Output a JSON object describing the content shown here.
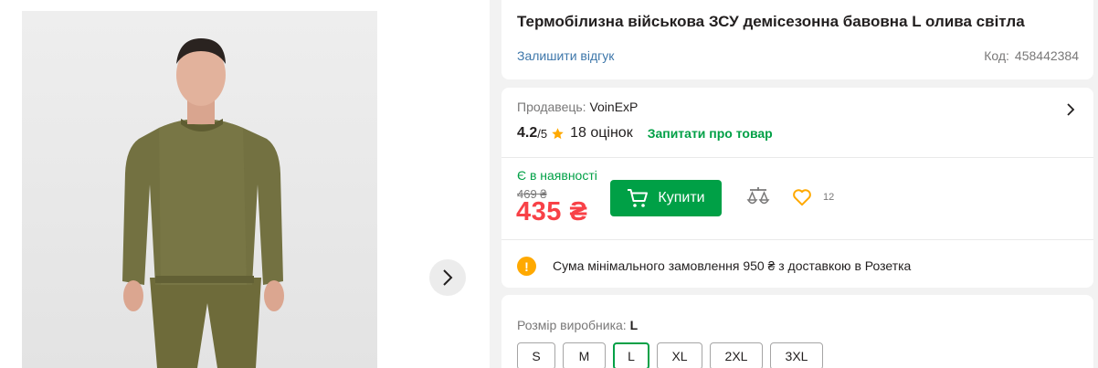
{
  "product": {
    "title": "Термобілизна військова ЗСУ демісезонна бавовна L олива світла",
    "review_link": "Залишити відгук",
    "code_label": "Код:",
    "code_value": "458442384"
  },
  "seller": {
    "label": "Продавець:",
    "name": "VoinExP",
    "rating": "4.2",
    "rating_max": "/5",
    "reviews": "18 оцінок",
    "ask_link": "Запитати про товар"
  },
  "purchase": {
    "availability": "Є в наявності",
    "old_price": "469 ₴",
    "price": "435 ₴",
    "buy_label": "Купити",
    "wishlist_count": "12"
  },
  "notice": {
    "icon_text": "!",
    "text": "Сума мінімального замовлення 950 ₴ з доставкою в Розетка"
  },
  "sizes": {
    "label": "Розмір виробника:",
    "selected": "L",
    "options": [
      "S",
      "M",
      "L",
      "XL",
      "2XL",
      "3XL"
    ]
  },
  "colors": {
    "accent_green": "#00a046",
    "price_red": "#f84147",
    "link_blue": "#3e77aa",
    "star_yellow": "#ffa900"
  },
  "icons": {
    "next": "chevron-right-icon",
    "cart": "cart-icon",
    "compare": "scales-icon",
    "wishlist": "heart-icon",
    "star": "star-icon",
    "notice": "warning-icon"
  }
}
